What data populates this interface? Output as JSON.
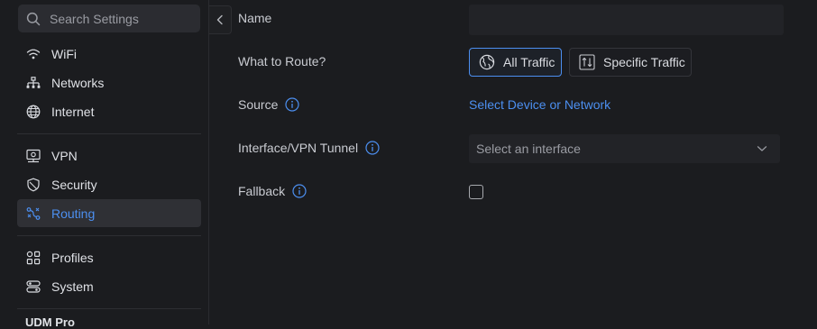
{
  "search": {
    "placeholder": "Search Settings"
  },
  "sidebar": {
    "items": [
      {
        "label": "WiFi",
        "icon": "wifi-icon"
      },
      {
        "label": "Networks",
        "icon": "networks-icon"
      },
      {
        "label": "Internet",
        "icon": "globe-icon"
      },
      {
        "label": "VPN",
        "icon": "vpn-icon"
      },
      {
        "label": "Security",
        "icon": "shield-icon"
      },
      {
        "label": "Routing",
        "icon": "routing-icon",
        "active": true
      },
      {
        "label": "Profiles",
        "icon": "profiles-icon"
      },
      {
        "label": "System",
        "icon": "system-icon"
      }
    ],
    "device": "UDM Pro"
  },
  "form": {
    "name_label": "Name",
    "name_value": "",
    "route_label": "What to Route?",
    "route_options": [
      {
        "label": "All Traffic",
        "selected": true
      },
      {
        "label": "Specific Traffic",
        "selected": false
      }
    ],
    "source_label": "Source",
    "source_link": "Select Device or Network",
    "interface_label": "Interface/VPN Tunnel",
    "interface_placeholder": "Select an interface",
    "fallback_label": "Fallback",
    "fallback_checked": false
  },
  "colors": {
    "accent": "#4c8ff0",
    "background": "#1b1c1f",
    "panel": "#222327"
  }
}
